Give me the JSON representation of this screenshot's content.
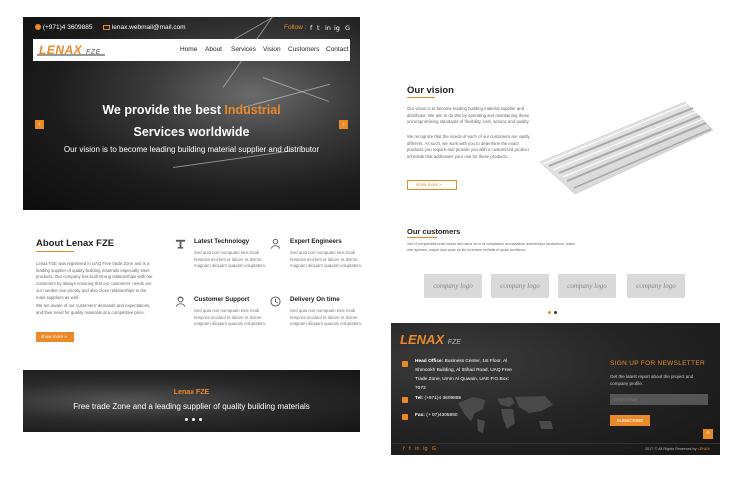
{
  "brand": {
    "logo_main": "LENAX",
    "logo_suffix": "FZE",
    "accent": "#e9892a"
  },
  "topbar": {
    "phone": "(+971)4 3609885",
    "email": "lenax.webmail@mail.com",
    "follow": "Follow :",
    "social": [
      "f",
      "t",
      "in",
      "ig",
      "G"
    ]
  },
  "nav": {
    "items": [
      "Home",
      "About",
      "Services",
      "Vision",
      "Customers",
      "Contact"
    ]
  },
  "hero": {
    "line1_pre": "We provide the best ",
    "line1_hl": "Industrial",
    "line2": "Services worldwide",
    "sub": "Our vision is to become leading building material supplier and distributor",
    "prev": "‹",
    "next": "›"
  },
  "about": {
    "title": "About Lenax FZE",
    "para1": "Lenax FZE was registered in UAQ Free trade Zone and is a leading supplier of quality building materials especially steel products. Our company has built strong relationships with our customers by always ensuring that our customers' needs are our number one priority and also close relationships to the main suppliers as well.",
    "para2": "We are aware of our customers' demands and expectations, and their need for quality materials at a competitive price.",
    "more": "show more »"
  },
  "features": [
    {
      "title": "Latest Technology",
      "text": "Sed quia non numquam eius modi tempora incidunt ut labore et dolore magnam aliquam quaerat voluptatem."
    },
    {
      "title": "Expert Engineers",
      "text": "Sed quia non numquam eius modi tempora incidunt ut labore et dolore magnam aliquam quaerat voluptatem."
    },
    {
      "title": "Customer Support",
      "text": "Sed quia non numquam eius modi tempora incidunt ut labore et dolore magnam aliquam quaerat voluptatem."
    },
    {
      "title": "Delivery On time",
      "text": "Sed quia non numquam eius modi tempora incidunt ut labore et dolore magnam aliquam quaerat voluptatem."
    }
  ],
  "banner": {
    "title": "Lenax FZE",
    "sub": "Free trade Zone and  a leading supplier of quality building materials"
  },
  "vision": {
    "title": "Our vision",
    "para1": "Our vision is to become leading building material supplier and distributor. We aim to do this by operating and maintaining these uncompromising standards of flexibility, cost, service and quality.",
    "para2": "We recognize that the needs of each of our customers are vastly different. As such, we work with you to determine the exact products you require and provide you with a customized product schedule that addresses your use for these products.",
    "more": "show more »"
  },
  "customers": {
    "title": "Our customers",
    "text": "Sed ut perspiciatis unde omnis iste natus error sit voluptatem accusantium doloremque laudantium, totam rem aperiam, eaque ipsa quae ab illo inventore veritatis et quasi architecto.",
    "logos": [
      "company logo",
      "company logo",
      "company logo",
      "company logo"
    ]
  },
  "footer": {
    "logo_main": "LENAX",
    "logo_suffix": "FZE",
    "office_label": "Head Office:",
    "office": "Business Center, 1st Floor, Al Shmookh Building, Al Ittihad Road, UAQ Free Trade Zone, Umm Al Quwain, UAE P.O.Box: 7073",
    "tel_label": "Tel:",
    "tel": "(+971)4 3609885",
    "fax_label": "Fax:",
    "fax": "(+ 97)4305860",
    "newsletter_title": "SIGN UP FOR NEWSLETTER",
    "newsletter_desc": "Get the latest report about the project and company profile.",
    "email_placeholder": "Enter email",
    "subscribe": "SUBSCRIBE",
    "copyright_pre": "2017 © All Rights Reserved by ",
    "copyright_brand": "LENAX",
    "up": "˄"
  }
}
